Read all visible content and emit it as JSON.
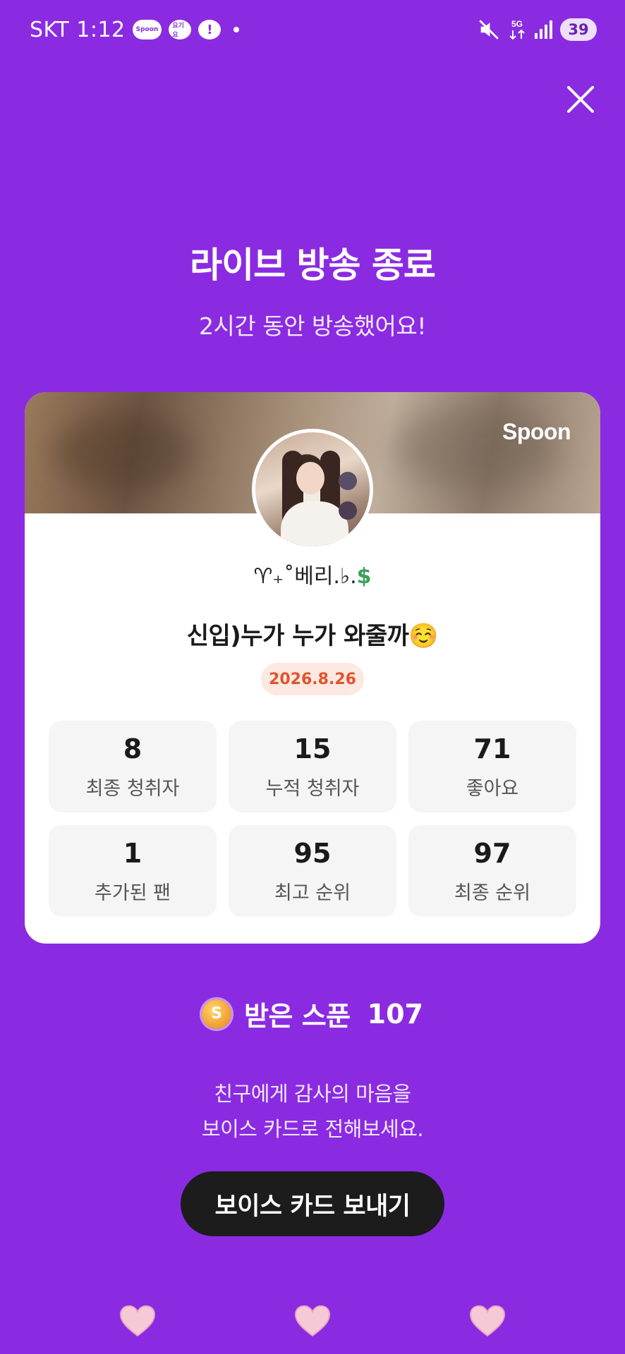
{
  "status_bar": {
    "carrier_time": "SKT 1:12",
    "app_icons": [
      "Spoon",
      "요기요",
      "!"
    ],
    "network": "5G",
    "battery": "39"
  },
  "header": {
    "title": "라이브 방송 종료",
    "subtitle": "2시간 동안 방송했어요!"
  },
  "card": {
    "brand": "Spoon",
    "nickname": "♈₊˚베리.♭.",
    "nickname_symbol": "$",
    "live_title": "신입)누가 누가 와줄까☺️",
    "date": "2026.8.26",
    "stats": [
      {
        "value": "8",
        "label": "최종 청취자"
      },
      {
        "value": "15",
        "label": "누적 청취자"
      },
      {
        "value": "71",
        "label": "좋아요"
      },
      {
        "value": "1",
        "label": "추가된 팬"
      },
      {
        "value": "95",
        "label": "최고 순위"
      },
      {
        "value": "97",
        "label": "최종 순위"
      }
    ]
  },
  "spoon": {
    "coin_letter": "S",
    "label": "받은 스푼",
    "count": "107"
  },
  "thanks": {
    "line1": "친구에게 감사의 마음을",
    "line2": "보이스 카드로 전해보세요."
  },
  "voice_card_button": "보이스 카드 보내기",
  "colors": {
    "background": "#8a2be2",
    "button": "#1c1c1c",
    "date_badge_text": "#e0532d",
    "heart": "#f6c9d6"
  }
}
